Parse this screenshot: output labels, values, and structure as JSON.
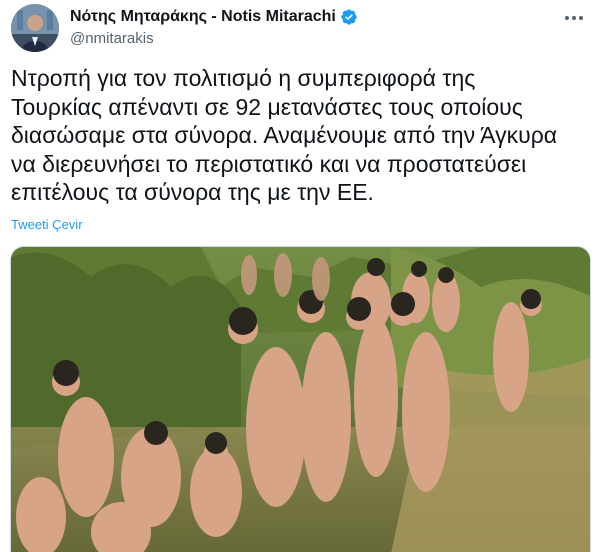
{
  "tweet": {
    "author": {
      "display_name": "Νότης Μηταράκης - Notis Mitarachi",
      "handle": "@nmitarakis",
      "verified": true,
      "avatar_icon": "profile-photo-avatar"
    },
    "more_icon": "more-options-icon",
    "text_lines": [
      "Ντροπή για τον πολιτισμό η συμπεριφορά της",
      "Τουρκίας απέναντι σε 92 μετανάστες τους οποίους",
      "διασώσαμε στα σύνορα. Αναμένουμε από την Άγκυρα",
      "να διερευνήσει το περιστατικό και να προστατεύσει",
      "επιτέλους τα σύνορα της με την ΕΕ."
    ],
    "translate_label": "Tweeti Çevir",
    "media": {
      "kind": "photo",
      "icon": "attached-photo"
    },
    "colors": {
      "link": "#1d9bf0",
      "verified": "#1d9bf0",
      "secondary_text": "#536471",
      "primary_text": "#0f1419"
    }
  }
}
